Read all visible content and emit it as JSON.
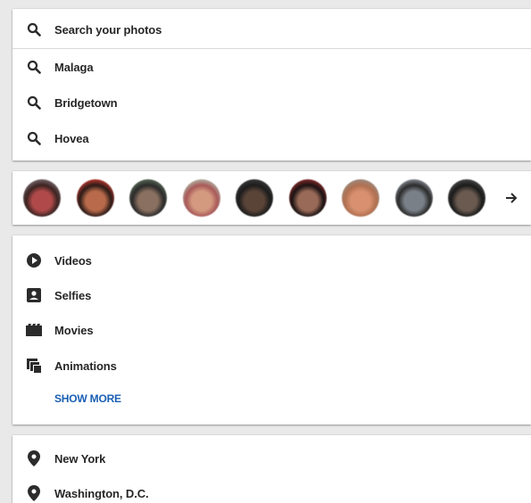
{
  "search": {
    "placeholder": "Search your photos",
    "suggestions": [
      {
        "label": "Malaga"
      },
      {
        "label": "Bridgetown"
      },
      {
        "label": "Hovea"
      }
    ]
  },
  "people": {
    "faces": [
      {
        "name": "person-1",
        "skin": "#b04a4a",
        "hair": "#3a2320",
        "bg": "#7a6a70"
      },
      {
        "name": "person-2",
        "skin": "#b86a4a",
        "hair": "#2b1a16",
        "bg": "#c23a30"
      },
      {
        "name": "person-3",
        "skin": "#8a7060",
        "hair": "#2a2a2a",
        "bg": "#5a6a58"
      },
      {
        "name": "person-4",
        "skin": "#d49a80",
        "hair": "#a85858",
        "bg": "#b0b8a8"
      },
      {
        "name": "person-5",
        "skin": "#5a4438",
        "hair": "#1c1c1c",
        "bg": "#3a3a3a"
      },
      {
        "name": "person-6",
        "skin": "#9a6a58",
        "hair": "#1a1212",
        "bg": "#8a2a2a"
      },
      {
        "name": "person-7",
        "skin": "#d89070",
        "hair": "#b07050",
        "bg": "#9a8a80"
      },
      {
        "name": "person-8",
        "skin": "#7a8088",
        "hair": "#2a2a2a",
        "bg": "#8a9098"
      },
      {
        "name": "person-9",
        "skin": "#6a5a50",
        "hair": "#1a1a1a",
        "bg": "#4a4848"
      }
    ],
    "more_icon": "arrow-right-icon"
  },
  "types": {
    "items": [
      {
        "label": "Videos",
        "icon": "play-circle-icon"
      },
      {
        "label": "Selfies",
        "icon": "portrait-icon"
      },
      {
        "label": "Movies",
        "icon": "film-icon"
      },
      {
        "label": "Animations",
        "icon": "animation-stack-icon"
      }
    ],
    "show_more": "SHOW MORE"
  },
  "places": {
    "items": [
      {
        "label": "New York",
        "icon": "place-pin-icon"
      },
      {
        "label": "Washington, D.C.",
        "icon": "place-pin-icon"
      }
    ]
  },
  "colors": {
    "accent": "#1a5fb4",
    "text": "#262626",
    "icon": "#2b2b2b",
    "background": "#e9e9e9"
  }
}
